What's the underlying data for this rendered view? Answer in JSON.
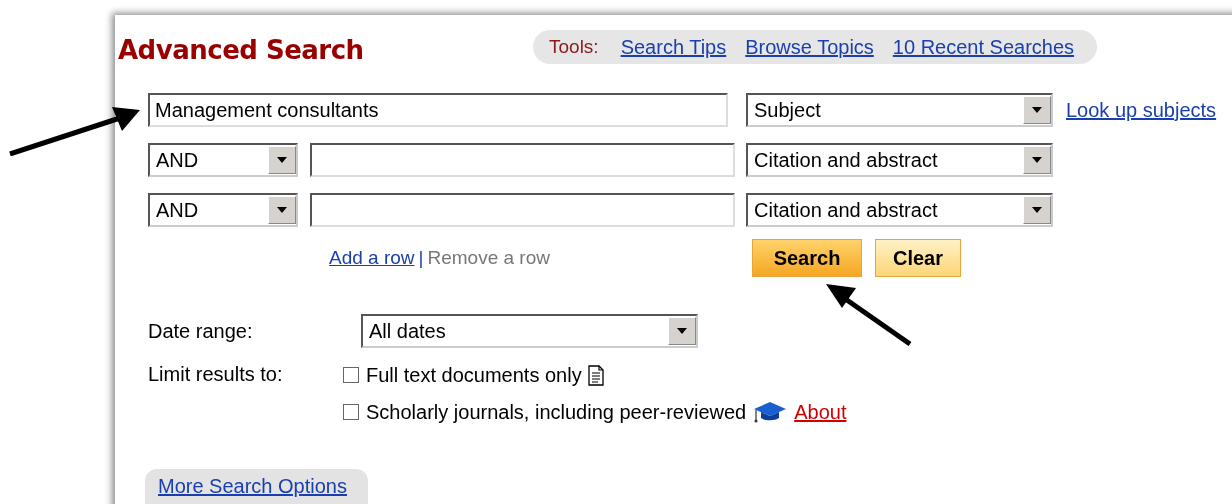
{
  "title": "Advanced Search",
  "tools": {
    "label": "Tools:",
    "links": [
      "Search Tips",
      "Browse Topics",
      "10 Recent Searches"
    ]
  },
  "search_rows": [
    {
      "value": "Management consultants",
      "field": "Subject",
      "link": "Look up subjects"
    },
    {
      "operator": "AND",
      "field": "Citation and abstract"
    },
    {
      "operator": "AND",
      "field": "Citation and abstract"
    }
  ],
  "row_links": [
    {
      "label": "Add a row",
      "disabled": false
    },
    {
      "label": "Remove a row",
      "disabled": true
    }
  ],
  "row_links_separator": "|",
  "buttons": [
    {
      "label": "Search",
      "kind": "primary"
    },
    {
      "label": "Clear",
      "kind": "secondary"
    }
  ],
  "date_range": {
    "label": "Date range:",
    "value": "All dates"
  },
  "limits": {
    "label": "Limit results to:",
    "options": [
      {
        "label": "Full text documents only",
        "checked": false,
        "kind": "full_text"
      },
      {
        "label": "Scholarly journals, including peer-reviewed",
        "checked": false,
        "kind": "scholarly",
        "link": "About"
      }
    ]
  },
  "more_options": "More Search Options"
}
